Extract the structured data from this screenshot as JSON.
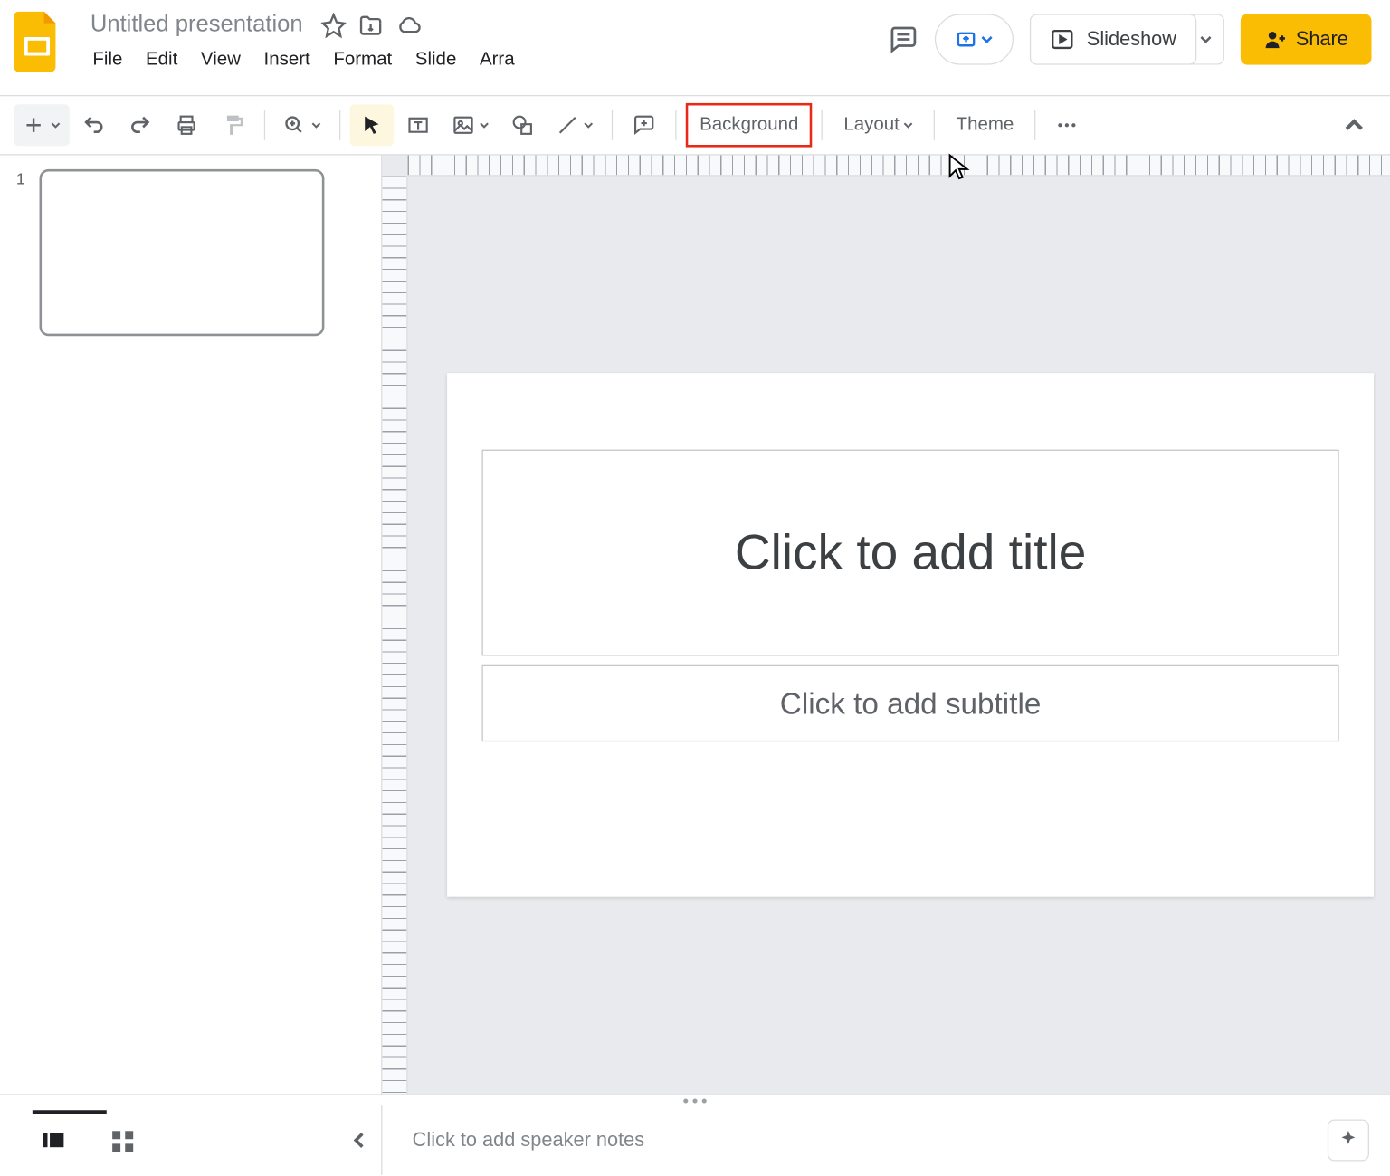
{
  "doc": {
    "title": "Untitled presentation"
  },
  "menu": {
    "file": "File",
    "edit": "Edit",
    "view": "View",
    "insert": "Insert",
    "format": "Format",
    "slide": "Slide",
    "arrange": "Arra"
  },
  "header": {
    "slideshow": "Slideshow",
    "share": "Share"
  },
  "toolbar": {
    "background": "Background",
    "layout": "Layout",
    "theme": "Theme"
  },
  "filmstrip": {
    "slide1_number": "1"
  },
  "slide": {
    "title_placeholder": "Click to add title",
    "subtitle_placeholder": "Click to add subtitle"
  },
  "bottom": {
    "notes_placeholder": "Click to add speaker notes"
  }
}
